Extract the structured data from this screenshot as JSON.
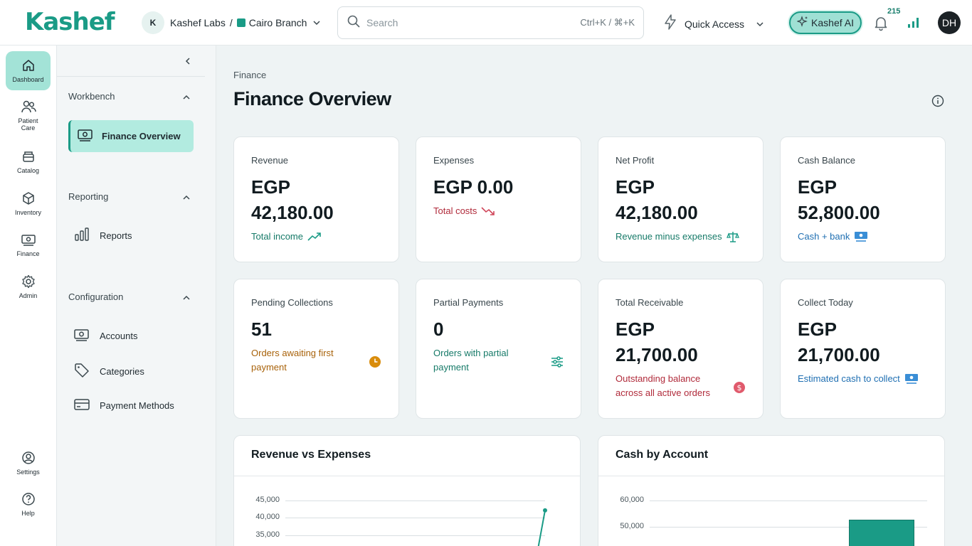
{
  "topbar": {
    "logo": "Kashef",
    "org_initial": "K",
    "org_name": "Kashef Labs",
    "separator": "/",
    "branch": "Cairo Branch",
    "search_placeholder": "Search",
    "search_shortcut": "Ctrl+K / ⌘+K",
    "quick_access": "Quick Access",
    "ai_label": "Kashef AI",
    "notification_count": "215",
    "user_initials": "DH",
    "accent": "#1a9b86"
  },
  "rail": {
    "items": [
      {
        "label": "Dashboard",
        "icon": "home-icon"
      },
      {
        "label": "Patient Care",
        "icon": "users-icon"
      },
      {
        "label": "Catalog",
        "icon": "catalog-icon"
      },
      {
        "label": "Inventory",
        "icon": "box-icon"
      },
      {
        "label": "Finance",
        "icon": "money-icon"
      },
      {
        "label": "Admin",
        "icon": "gear-icon"
      },
      {
        "label": "Settings",
        "icon": "user-circle-icon"
      },
      {
        "label": "Help",
        "icon": "help-icon"
      }
    ]
  },
  "sidenav": {
    "sections": [
      {
        "title": "Workbench",
        "items": [
          "Finance Overview"
        ]
      },
      {
        "title": "Reporting",
        "items": [
          "Reports"
        ]
      },
      {
        "title": "Configuration",
        "items": [
          "Accounts",
          "Categories",
          "Payment Methods"
        ]
      }
    ]
  },
  "main": {
    "breadcrumb": "Finance",
    "title": "Finance Overview",
    "cards": [
      {
        "label": "Revenue",
        "value_prefix": "EGP",
        "value": "42,180.00",
        "sub": "Total income",
        "sub_color": "#167a68"
      },
      {
        "label": "Expenses",
        "value_prefix": "EGP",
        "value": "0.00",
        "sub": "Total costs",
        "sub_color": "#b02a3a"
      },
      {
        "label": "Net Profit",
        "value_prefix": "EGP",
        "value": "42,180.00",
        "sub": "Revenue minus expenses",
        "sub_color": "#167a68"
      },
      {
        "label": "Cash Balance",
        "value_prefix": "EGP",
        "value": "52,800.00",
        "sub": "Cash + bank",
        "sub_color": "#1f6fb2"
      },
      {
        "label": "Pending Collections",
        "value_prefix": "",
        "value": "51",
        "sub": "Orders awaiting first payment",
        "sub_color": "#a8620a"
      },
      {
        "label": "Partial Payments",
        "value_prefix": "",
        "value": "0",
        "sub": "Orders with partial payment",
        "sub_color": "#167a68"
      },
      {
        "label": "Total Receivable",
        "value_prefix": "EGP",
        "value": "21,700.00",
        "sub": "Outstanding balance across all active orders",
        "sub_color": "#b02a3a"
      },
      {
        "label": "Collect Today",
        "value_prefix": "EGP",
        "value": "21,700.00",
        "sub": "Estimated cash to collect",
        "sub_color": "#1f6fb2"
      }
    ],
    "panels": [
      {
        "title": "Revenue vs Expenses",
        "ticks": [
          "45,000",
          "40,000",
          "35,000"
        ]
      },
      {
        "title": "Cash by Account",
        "ticks": [
          "60,000",
          "50,000"
        ]
      }
    ]
  },
  "chart_data": [
    {
      "type": "line",
      "title": "Revenue vs Expenses",
      "ylim": [
        35000,
        45000
      ],
      "yticks": [
        45000,
        40000,
        35000
      ],
      "series": [
        {
          "values": [
            42180
          ]
        }
      ]
    },
    {
      "type": "bar",
      "title": "Cash by Account",
      "yticks": [
        60000,
        50000
      ],
      "values": [
        52800
      ]
    }
  ]
}
